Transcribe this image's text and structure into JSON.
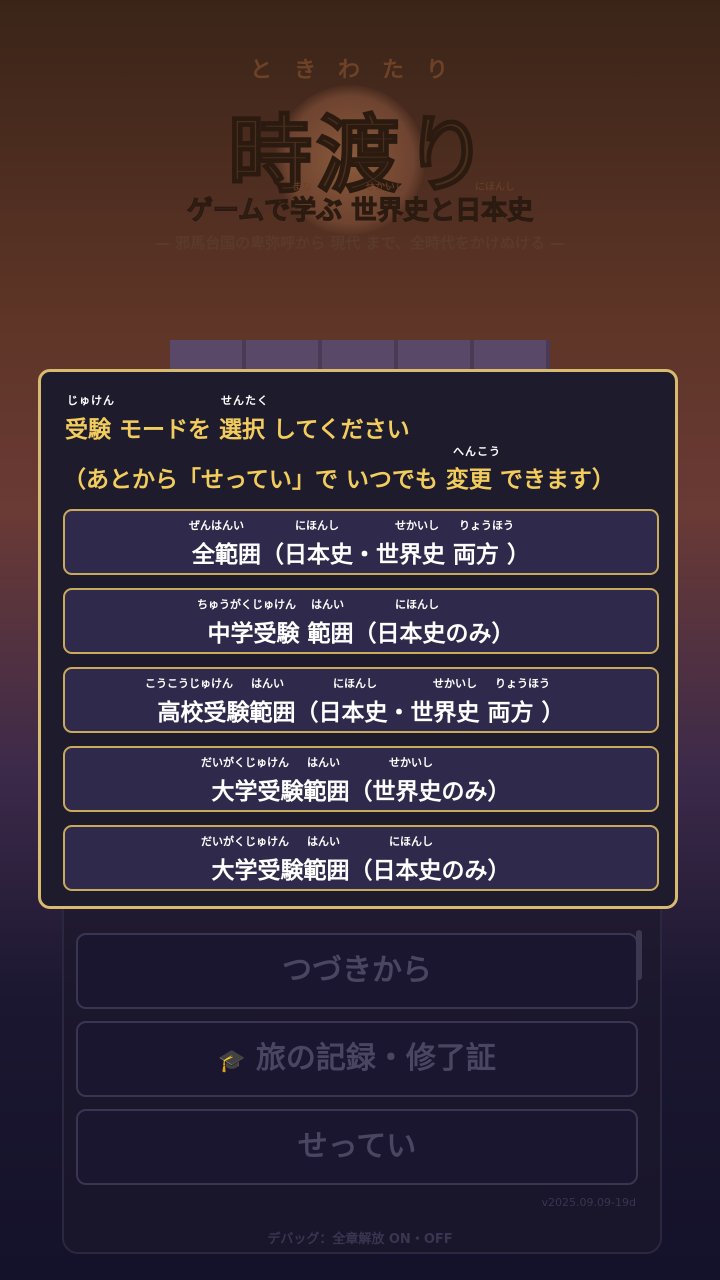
{
  "background": {
    "title_ruby": "ときわたり",
    "title": "時渡り",
    "subtitle": "ゲームで学ぶ 世界史と日本史",
    "subtitle_ruby": [
      "まな",
      "せかいし",
      "にほんし"
    ],
    "tagline": "— 邪馬台国の卑弥呼から 現代 まで、全時代をかけぬける —",
    "menu_buttons": [
      "つづきから",
      "旅の記録・修了証",
      "せってい"
    ],
    "version": "v2025.09.09-19d",
    "debug_toggle": "デバッグ：全章解放 ON・OFF"
  },
  "modal": {
    "heading_ruby": [
      "じゅけん",
      "せんたく"
    ],
    "heading": "受験 モードを 選択 してください",
    "note_ruby": "へんこう",
    "note": "（あとから「せってい」で いつでも 変更 できます）",
    "options": [
      {
        "ruby": [
          "ぜんはんい",
          "にほんし",
          "せかいし",
          "りょうほう"
        ],
        "label": "全範囲（日本史・世界史 両方 ）"
      },
      {
        "ruby": [
          "ちゅうがくじゅけん",
          "はんい",
          "にほんし"
        ],
        "label": "中学受験 範囲（日本史のみ）"
      },
      {
        "ruby": [
          "こうこうじゅけん",
          "はんい",
          "にほんし",
          "せかいし",
          "りょうほう"
        ],
        "label": "高校受験範囲（日本史・世界史 両方 ）"
      },
      {
        "ruby": [
          "だいがくじゅけん",
          "はんい",
          "せかいし"
        ],
        "label": "大学受験範囲（世界史のみ）"
      },
      {
        "ruby": [
          "だいがくじゅけん",
          "はんい",
          "にほんし"
        ],
        "label": "大学受験範囲（日本史のみ）"
      }
    ]
  },
  "colors": {
    "accent_gold": "#f2cd5d",
    "border_gold": "#d8bb70",
    "modal_bg": "#1e1b2d",
    "option_bg": "#2f2a4b"
  }
}
